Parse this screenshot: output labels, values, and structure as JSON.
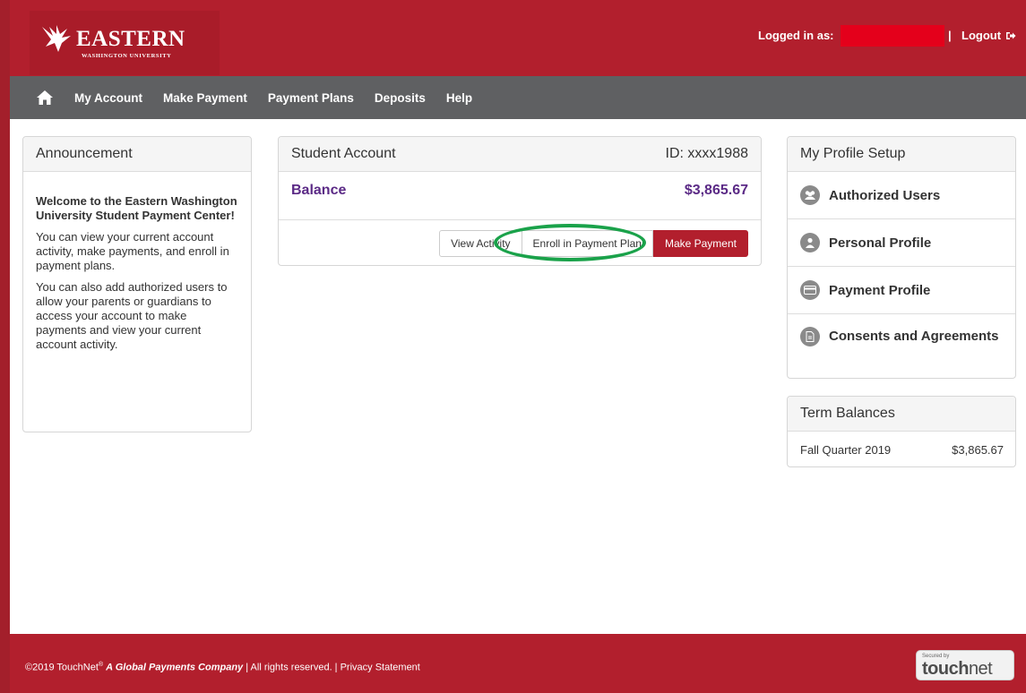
{
  "header": {
    "logo_text": "EASTERN",
    "logo_sub": "WASHINGTON UNIVERSITY",
    "logged_in_label": "Logged in as:",
    "separator": "|",
    "logout_label": "Logout"
  },
  "nav": {
    "items": [
      "My Account",
      "Make Payment",
      "Payment Plans",
      "Deposits",
      "Help"
    ]
  },
  "announcement": {
    "title": "Announcement",
    "heading": "Welcome to the Eastern Washington University Student Payment Center!",
    "para1": "You can view your current account activity, make payments, and enroll in payment plans.",
    "para2": "You can also add authorized users to allow your parents or guardians to access your account to make payments and view your current account activity."
  },
  "account": {
    "title": "Student Account",
    "id_label": "ID: xxxx1988",
    "balance_label": "Balance",
    "balance_value": "$3,865.67",
    "view_activity": "View Activity",
    "enroll_plan": "Enroll in Payment Plan",
    "make_payment": "Make Payment"
  },
  "profile": {
    "title": "My Profile Setup",
    "items": [
      "Authorized Users",
      "Personal Profile",
      "Payment Profile",
      "Consents and Agreements"
    ]
  },
  "term": {
    "title": "Term Balances",
    "term_name": "Fall Quarter 2019",
    "term_value": "$3,865.67"
  },
  "footer": {
    "copyright": "©2019 TouchNet",
    "reg": "®",
    "company": "A Global Payments Company",
    "rights": "| All rights reserved. | Privacy Statement",
    "badge_small": "Secured by",
    "badge_touch": "touch",
    "badge_net": "net"
  },
  "colors": {
    "brand_red": "#b21f2d",
    "nav_gray": "#5f6062",
    "balance_purple": "#5b2a86",
    "highlight_green": "#1aa24a"
  }
}
